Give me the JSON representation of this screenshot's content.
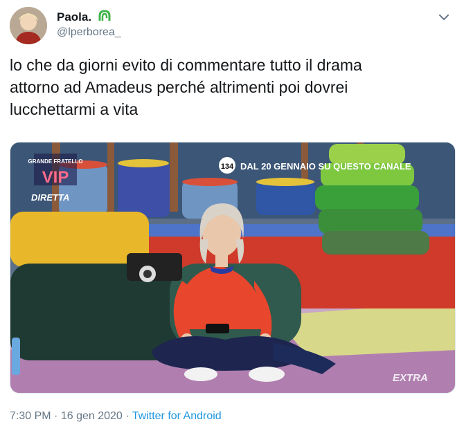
{
  "user": {
    "display_name": "Paola.",
    "handle": "@lperborea_"
  },
  "tweet": {
    "text_lines": [
      "lo che da giorni evito di commentare tutto il drama",
      "attorno ad Amadeus perché altrimenti poi dovrei",
      "lucchettarmi a vita"
    ],
    "time": "7:30 PM",
    "separator": "·",
    "date": "16 gen 2020",
    "source": "Twitter for Android"
  },
  "media": {
    "show_logo_top": "GRANDE FRATELLO",
    "show_logo_main": "VIP",
    "live_label": "DIRETTA",
    "channel_logo": "134",
    "banner_text": "DAL 20 GENNAIO SU QUESTO CANALE",
    "corner_logo": "EXTRA"
  },
  "icons": {
    "badge": "app-badge-icon",
    "menu": "chevron-down-icon"
  },
  "colors": {
    "text": "#14171a",
    "secondary": "#657786",
    "link": "#1b95e0"
  }
}
